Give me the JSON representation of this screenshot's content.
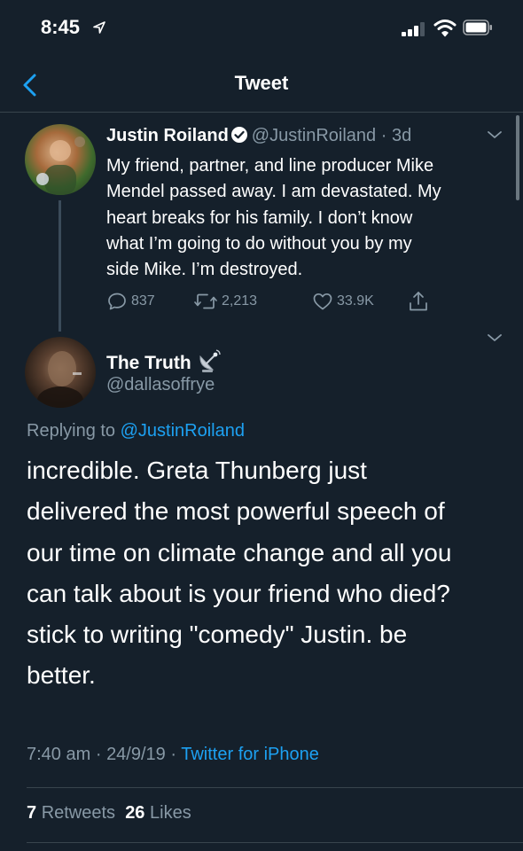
{
  "status_bar": {
    "time": "8:45"
  },
  "nav": {
    "title": "Tweet"
  },
  "tweet1": {
    "name": "Justin Roiland",
    "handle": "@JustinRoiland",
    "separator": "·",
    "age": "3d",
    "lines": [
      "My friend, partner, and line producer Mike",
      "Mendel passed away. I am devastated. My",
      "heart breaks for his family. I don’t know",
      "what I’m going to do without you by my",
      "side Mike. I’m destroyed."
    ],
    "replies": "837",
    "retweets": "2,213",
    "likes": "33.9K"
  },
  "tweet2": {
    "name": "The Truth",
    "handle": "@dallasoffrye",
    "replying_prefix": "Replying to",
    "replying_to": "@JustinRoiland",
    "lines": [
      "incredible. Greta Thunberg just",
      "delivered the most powerful speech of",
      "our time on climate change and all you",
      "can talk about is your friend who died?",
      "stick to writing \"comedy\" Justin. be",
      "better."
    ],
    "time": "7:40 am",
    "separator": "·",
    "date": "24/9/19",
    "source": "Twitter for iPhone",
    "retweets_count": "7",
    "retweets_label": "Retweets",
    "likes_count": "26",
    "likes_label": "Likes"
  },
  "colors": {
    "background": "#15202b",
    "accent": "#1da1f2",
    "secondary_text": "#8899a6",
    "divider": "#38444d"
  },
  "icons": {
    "back": "chevron-left-icon",
    "verified": "verified-badge-icon",
    "reply": "speech-bubble-icon",
    "retweet": "retweet-icon",
    "like": "heart-icon",
    "share": "share-icon",
    "more": "chevron-down-icon",
    "emoji": "satellite-antenna-icon"
  }
}
